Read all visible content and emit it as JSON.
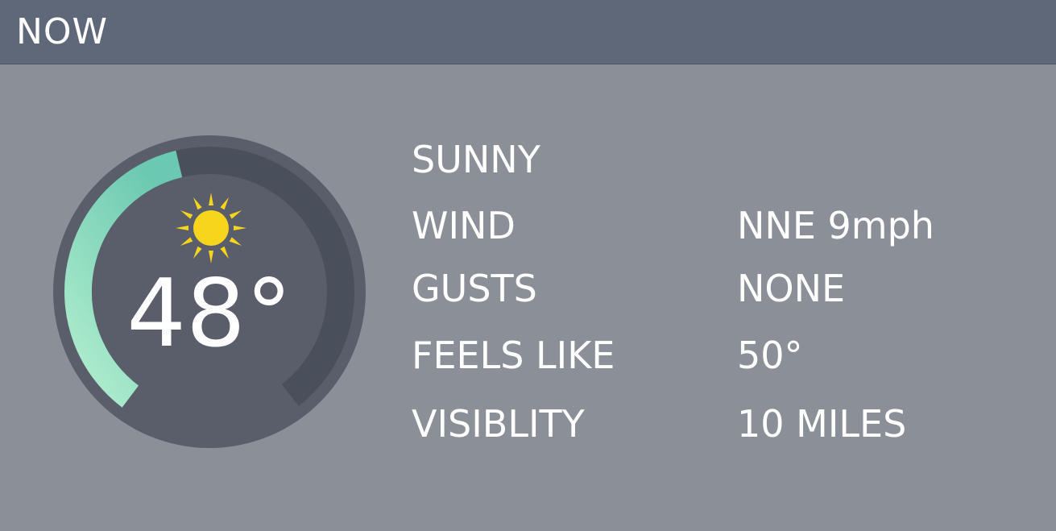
{
  "header": {
    "title": "NOW"
  },
  "current": {
    "temperature": "48°",
    "condition": "SUNNY",
    "condition_icon": "sun-icon",
    "gauge_fill_fraction": 0.36,
    "gauge_colors": {
      "start": "#b3efcf",
      "end": "#6cc9b1",
      "track": "#4a4f5c",
      "face": "#595e6a"
    }
  },
  "details": [
    {
      "label": "WIND",
      "value": "NNE 9mph"
    },
    {
      "label": "GUSTS",
      "value": "NONE"
    },
    {
      "label": "FEELS LIKE",
      "value": "50°"
    },
    {
      "label": "VISIBLITY",
      "value": "10 MILES"
    }
  ],
  "colors": {
    "header_bg": "#5f6878",
    "panel_bg": "#8b8f98",
    "sun": "#f7d51d"
  }
}
